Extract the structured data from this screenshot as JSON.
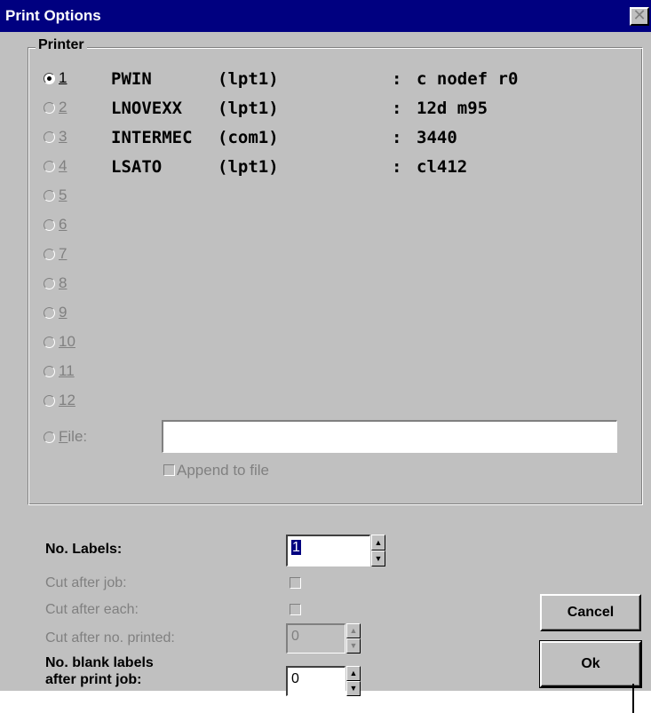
{
  "window": {
    "title": "Print Options",
    "close_glyph": "✕"
  },
  "printer_group": {
    "label": "Printer",
    "radios": [
      {
        "num": "1",
        "selected": true,
        "enabled": true
      },
      {
        "num": "2",
        "selected": false,
        "enabled": false
      },
      {
        "num": "3",
        "selected": false,
        "enabled": false
      },
      {
        "num": "4",
        "selected": false,
        "enabled": false
      },
      {
        "num": "5",
        "selected": false,
        "enabled": false
      },
      {
        "num": "6",
        "selected": false,
        "enabled": false
      },
      {
        "num": "7",
        "selected": false,
        "enabled": false
      },
      {
        "num": "8",
        "selected": false,
        "enabled": false
      },
      {
        "num": "9",
        "selected": false,
        "enabled": false
      },
      {
        "num": "10",
        "selected": false,
        "enabled": false
      },
      {
        "num": "11",
        "selected": false,
        "enabled": false
      },
      {
        "num": "12",
        "selected": false,
        "enabled": false
      }
    ],
    "printers": [
      {
        "name": "PWIN",
        "port": "(lpt1)",
        "sep": ":",
        "driver": "c nodef r0"
      },
      {
        "name": "LNOVEXX",
        "port": "(lpt1)",
        "sep": ":",
        "driver": "12d m95"
      },
      {
        "name": "INTERMEC",
        "port": "(com1)",
        "sep": ":",
        "driver": "3440"
      },
      {
        "name": "LSATO",
        "port": "(lpt1)",
        "sep": ":",
        "driver": "cl412"
      }
    ],
    "file": {
      "label_prefix": "F",
      "label_rest": "ile:",
      "value": ""
    },
    "append_to_file": {
      "label": "Append to file",
      "checked": false
    }
  },
  "options": {
    "no_labels": {
      "label": "No. Labels:",
      "value": "1"
    },
    "cut_after_job": {
      "label": "Cut after job:",
      "checked": false
    },
    "cut_after_each": {
      "label": "Cut after each:",
      "checked": false
    },
    "cut_after_no_printed": {
      "label": "Cut after no. printed:",
      "value": "0"
    },
    "no_blank_labels": {
      "label_line1": "No. blank labels",
      "label_line2": "after print job:",
      "value": "0"
    }
  },
  "buttons": {
    "cancel": "Cancel",
    "ok": "Ok"
  },
  "icons": {
    "spin_up": "▲",
    "spin_down": "▼"
  },
  "colors": {
    "titlebar": "#000080",
    "face": "#c0c0c0",
    "disabled_text": "#808080"
  }
}
